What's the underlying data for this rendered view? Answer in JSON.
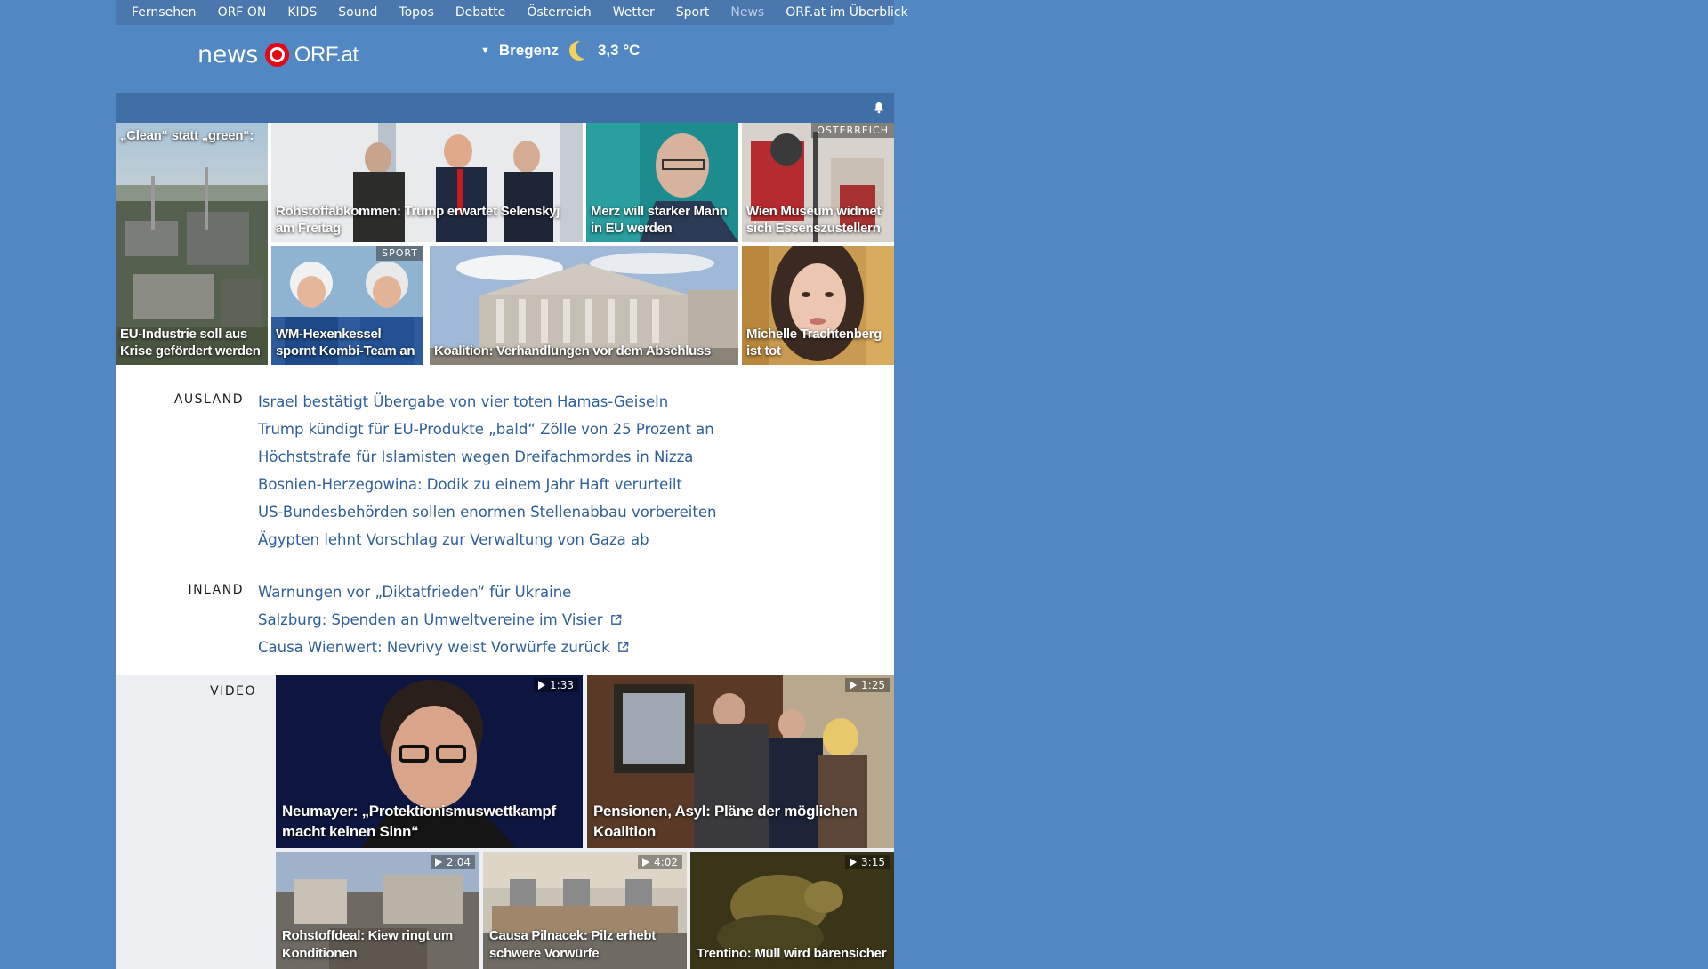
{
  "orfbar": {
    "items": [
      "Fernsehen",
      "ORF ON",
      "KIDS",
      "Sound",
      "Topos",
      "Debatte",
      "Österreich",
      "Wetter",
      "Sport",
      "News"
    ],
    "overview": "ORF.at im Überblick"
  },
  "header": {
    "logo_news": "news",
    "logo_orf": "ORF.at",
    "weather_city": "Bregenz",
    "weather_temp": "3,3 °C"
  },
  "tiles": [
    {
      "caption": "„Clean“ statt „green“:",
      "caption2": "EU-Industrie soll aus Krise gefördert werden",
      "tag": ""
    },
    {
      "caption": "Rohstoffabkommen: Trump erwartet Selenskyj am Freitag",
      "tag": ""
    },
    {
      "caption": "Merz will starker Mann in EU werden",
      "tag": ""
    },
    {
      "caption": "Wien Museum widmet sich Essenszustellern",
      "tag": "ÖSTERREICH"
    },
    {
      "caption": "WM-Hexenkessel spornt Kombi-Team an",
      "tag": "SPORT"
    },
    {
      "caption": "Koalition: Verhandlungen vor dem Abschluss",
      "tag": ""
    },
    {
      "caption": "Michelle Trachtenberg ist tot",
      "tag": ""
    }
  ],
  "sections": {
    "ausland": {
      "label": "AUSLAND",
      "links": [
        "Israel bestätigt Übergabe von vier toten Hamas-Geiseln",
        "Trump kündigt für EU-Produkte „bald“ Zölle von 25 Prozent an",
        "Höchststrafe für Islamisten wegen Dreifachmordes in Nizza",
        "Bosnien-Herzegowina: Dodik zu einem Jahr Haft verurteilt",
        "US-Bundesbehörden sollen enormen Stellenabbau vorbereiten",
        "Ägypten lehnt Vorschlag zur Verwaltung von Gaza ab"
      ]
    },
    "inland": {
      "label": "INLAND",
      "links": [
        "Warnungen vor „Diktatfrieden“ für Ukraine",
        "Salzburg: Spenden an Umweltvereine im Visier",
        "Causa Wienwert: Nevrivy weist Vorwürfe zurück"
      ]
    }
  },
  "video": {
    "label": "VIDEO",
    "items": [
      {
        "caption": "Neumayer: „Protektionismuswettkampf macht keinen Sinn“",
        "duration": "1:33"
      },
      {
        "caption": "Pensionen, Asyl: Pläne der möglichen Koalition",
        "duration": "1:25"
      },
      {
        "caption": "Rohstoffdeal: Kiew ringt um Konditionen",
        "duration": "2:04"
      },
      {
        "caption": "Causa Pilnacek: Pilz erhebt schwere Vorwürfe",
        "duration": "4:02"
      },
      {
        "caption": "Trentino: Müll wird bärensicher",
        "duration": "3:15"
      }
    ]
  },
  "colors": {
    "page_bg": "#5187c3",
    "link": "#2f5f99",
    "orf_red": "#e30613"
  }
}
